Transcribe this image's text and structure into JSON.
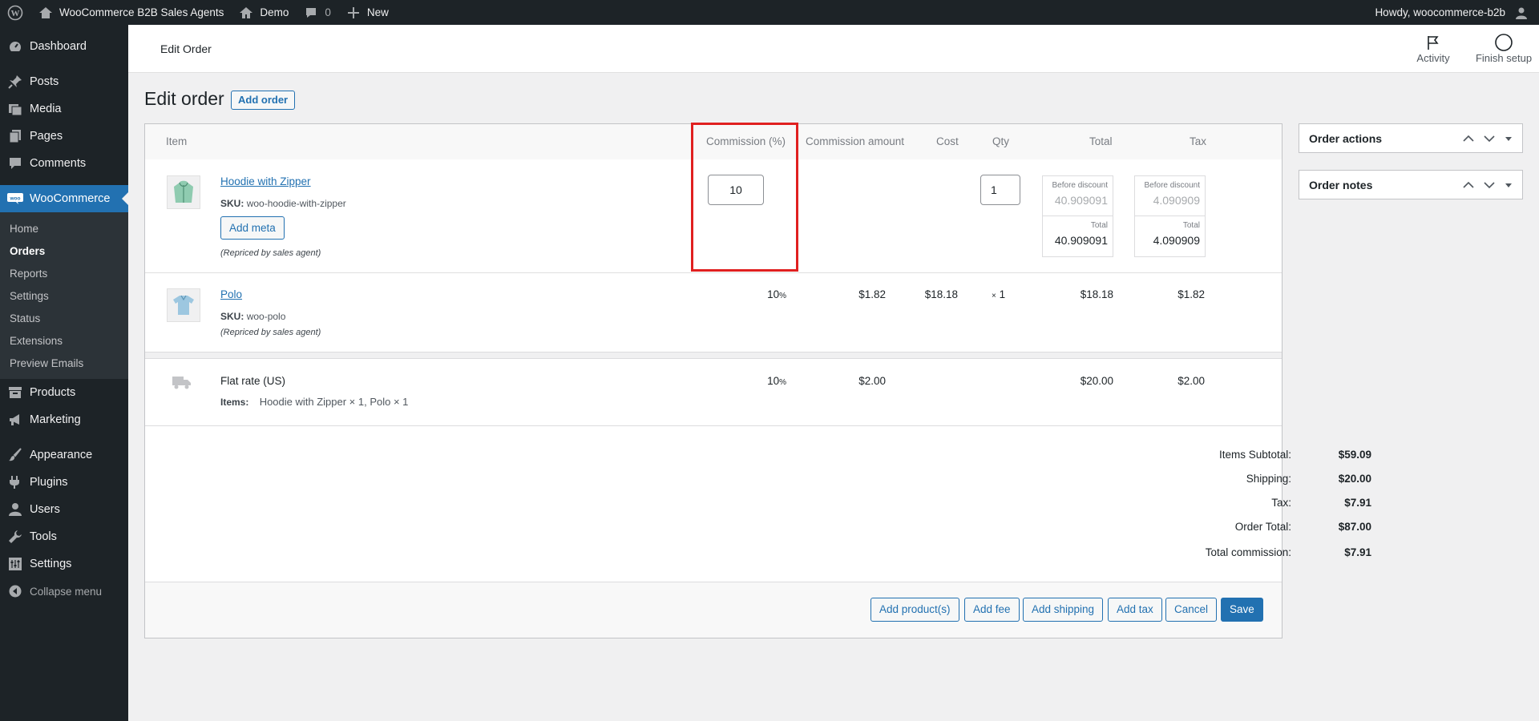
{
  "adminbar": {
    "site_name": "WooCommerce B2B Sales Agents",
    "demo": "Demo",
    "comments_count": "0",
    "new_label": "New",
    "howdy": "Howdy, woocommerce-b2b"
  },
  "sidebar": {
    "dashboard": "Dashboard",
    "posts": "Posts",
    "media": "Media",
    "pages": "Pages",
    "comments": "Comments",
    "woocommerce": "WooCommerce",
    "sub": [
      "Home",
      "Orders",
      "Reports",
      "Settings",
      "Status",
      "Extensions",
      "Preview Emails"
    ],
    "products": "Products",
    "marketing": "Marketing",
    "appearance": "Appearance",
    "plugins": "Plugins",
    "users": "Users",
    "tools": "Tools",
    "settings": "Settings",
    "collapse": "Collapse menu"
  },
  "header": {
    "title": "Edit Order",
    "activity": "Activity",
    "finish_setup": "Finish setup"
  },
  "page": {
    "title": "Edit order",
    "add_order": "Add order"
  },
  "table": {
    "headers": {
      "item": "Item",
      "commission_pct": "Commission (%)",
      "commission_amount": "Commission amount",
      "cost": "Cost",
      "qty": "Qty",
      "total": "Total",
      "tax": "Tax"
    },
    "item1": {
      "name": "Hoodie with Zipper",
      "sku_label": "SKU:",
      "sku": "woo-hoodie-with-zipper",
      "add_meta": "Add meta",
      "note": "(Repriced by sales agent)",
      "commission_input": "10",
      "qty_input": "1",
      "before_discount_label": "Before discount",
      "total_label": "Total",
      "total_before": "40.909091",
      "total_after": "40.909091",
      "tax_before": "4.090909",
      "tax_after": "4.090909"
    },
    "item2": {
      "name": "Polo",
      "sku_label": "SKU:",
      "sku": "woo-polo",
      "note": "(Repriced by sales agent)",
      "commission": "10",
      "pct": "%",
      "commission_amount": "$1.82",
      "cost": "$18.18",
      "qty_x": "×",
      "qty": "1",
      "total": "$18.18",
      "tax": "$1.82"
    },
    "shipping": {
      "name": "Flat rate (US)",
      "items_label": "Items:",
      "items": "Hoodie with Zipper × 1, Polo × 1",
      "commission": "10",
      "pct": "%",
      "commission_amount": "$2.00",
      "total": "$20.00",
      "tax": "$2.00"
    }
  },
  "totals": [
    {
      "label": "Items Subtotal:",
      "value": "$59.09"
    },
    {
      "label": "Shipping:",
      "value": "$20.00"
    },
    {
      "label": "Tax:",
      "value": "$7.91"
    },
    {
      "label": "Order Total:",
      "value": "$87.00"
    },
    {
      "label": "Total commission:",
      "value": "$7.91"
    }
  ],
  "actions": {
    "add_products": "Add product(s)",
    "add_fee": "Add fee",
    "add_shipping": "Add shipping",
    "add_tax": "Add tax",
    "cancel": "Cancel",
    "save": "Save"
  },
  "side": {
    "order_actions": "Order actions",
    "order_notes": "Order notes"
  },
  "colors": {
    "admin_dark": "#1d2327",
    "accent": "#2271b1",
    "highlight": "#e02020"
  }
}
